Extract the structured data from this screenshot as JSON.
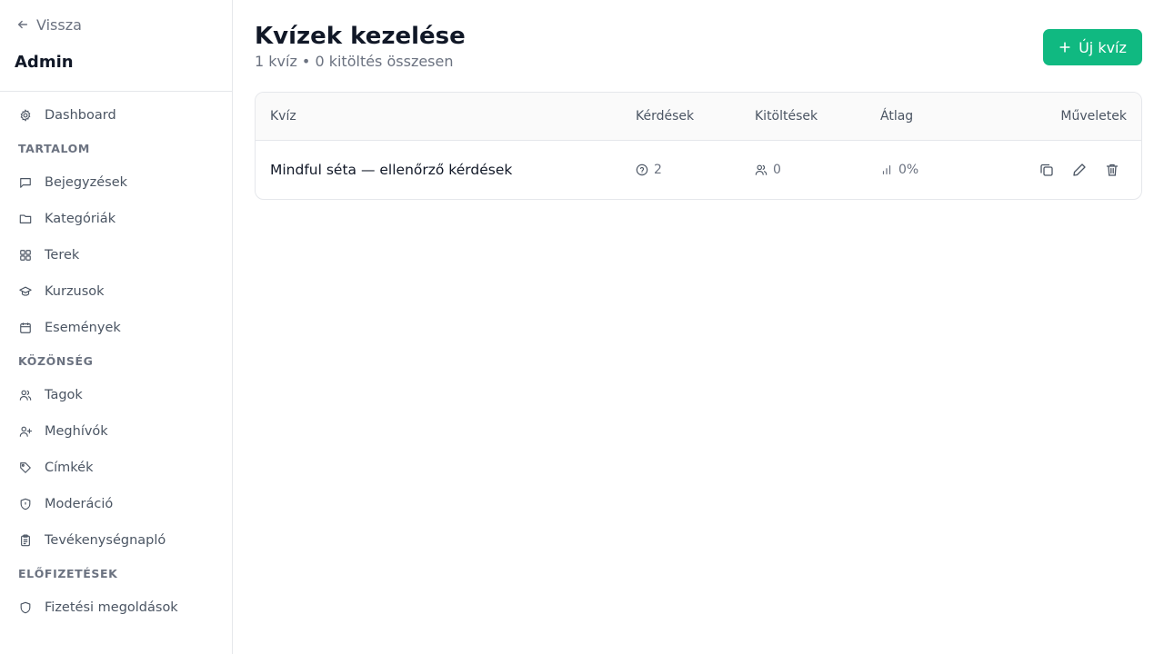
{
  "sidebar": {
    "back_label": "Vissza",
    "title": "Admin",
    "dashboard": "Dashboard",
    "sections": {
      "content": "TARTALOM",
      "audience": "KÖZÖNSÉG",
      "subscriptions": "ELŐFIZETÉSEK"
    },
    "content_items": [
      "Bejegyzések",
      "Kategóriák",
      "Terek",
      "Kurzusok",
      "Események"
    ],
    "audience_items": [
      "Tagok",
      "Meghívók",
      "Címkék",
      "Moderáció",
      "Tevékenységnapló"
    ],
    "subscription_items": [
      "Fizetési megoldások"
    ]
  },
  "header": {
    "title": "Kvízek kezelése",
    "subtitle": "1 kvíz • 0 kitöltés összesen",
    "new_button": "Új kvíz"
  },
  "table": {
    "columns": [
      "Kvíz",
      "Kérdések",
      "Kitöltések",
      "Átlag",
      "Műveletek"
    ],
    "rows": [
      {
        "name": "Mindful séta — ellenőrző kérdések",
        "questions": "2",
        "completions": "0",
        "average": "0%"
      }
    ]
  },
  "colors": {
    "accent": "#10b981",
    "border": "#e5e7eb",
    "muted": "#6b7280"
  }
}
